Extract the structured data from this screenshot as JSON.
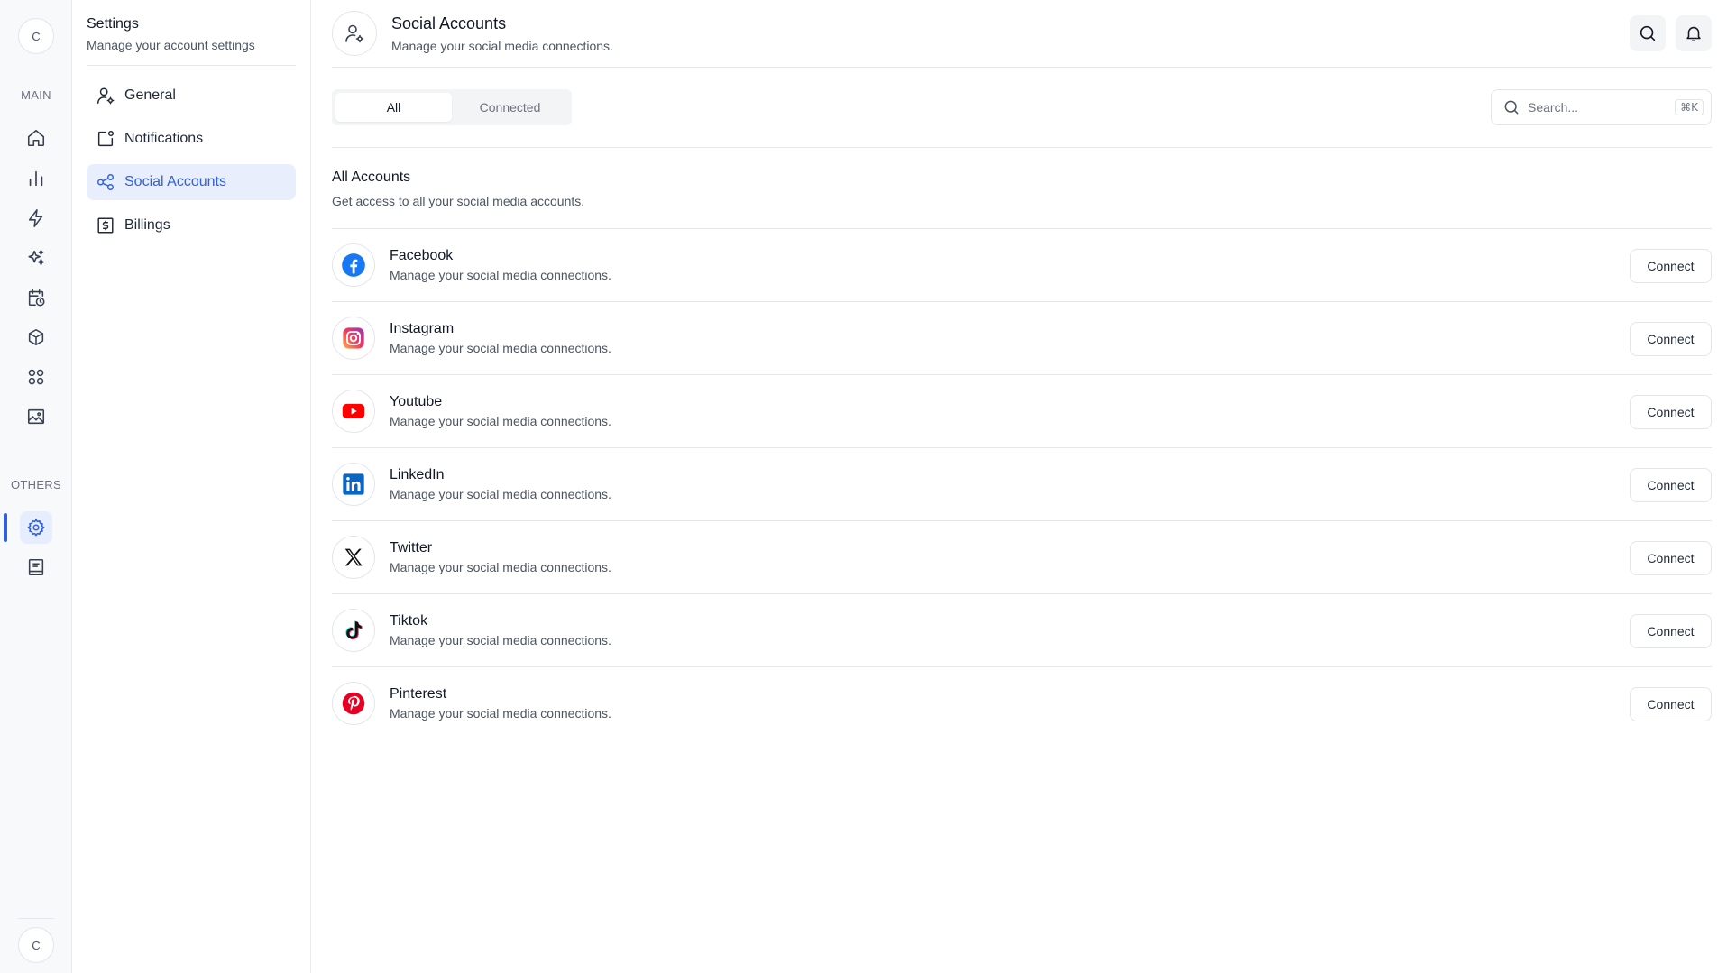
{
  "rail": {
    "avatar_top": "C",
    "avatar_bottom": "C",
    "main_label": "MAIN",
    "others_label": "OTHERS",
    "main_icons": [
      "home-icon",
      "bar-chart-icon",
      "lightning-icon",
      "sparkles-icon",
      "calendar-clock-icon",
      "cube-icon",
      "apps-grid-icon",
      "image-icon"
    ],
    "other_icons": [
      "gear-icon",
      "book-icon"
    ]
  },
  "subnav": {
    "title": "Settings",
    "subtitle": "Manage your account settings",
    "items": [
      {
        "label": "General",
        "icon": "user-gear-icon"
      },
      {
        "label": "Notifications",
        "icon": "notification-icon"
      },
      {
        "label": "Social Accounts",
        "icon": "share-icon",
        "active": true
      },
      {
        "label": "Billings",
        "icon": "billing-icon"
      }
    ]
  },
  "header": {
    "title": "Social Accounts",
    "subtitle": "Manage your social media connections."
  },
  "tabs": [
    {
      "label": "All",
      "active": true
    },
    {
      "label": "Connected",
      "active": false
    }
  ],
  "search": {
    "placeholder": "Search...",
    "shortcut": "⌘K"
  },
  "section": {
    "title": "All Accounts",
    "subtitle": "Get access to all your social media accounts."
  },
  "accounts": [
    {
      "name": "Facebook",
      "description": "Manage your social media connections.",
      "action": "Connect"
    },
    {
      "name": "Instagram",
      "description": "Manage your social media connections.",
      "action": "Connect"
    },
    {
      "name": "Youtube",
      "description": "Manage your social media connections.",
      "action": "Connect"
    },
    {
      "name": "LinkedIn",
      "description": "Manage your social media connections.",
      "action": "Connect"
    },
    {
      "name": "Twitter",
      "description": "Manage your social media connections.",
      "action": "Connect"
    },
    {
      "name": "Tiktok",
      "description": "Manage your social media connections.",
      "action": "Connect"
    },
    {
      "name": "Pinterest",
      "description": "Manage your social media connections.",
      "action": "Connect"
    }
  ],
  "colors": {
    "accent": "#2f5fe3",
    "active_bg": "#e8eefc",
    "border": "#e5e7eb",
    "facebook": "#1877f2",
    "youtube": "#ff0000",
    "linkedin": "#0a66c2",
    "pinterest": "#e60023"
  }
}
